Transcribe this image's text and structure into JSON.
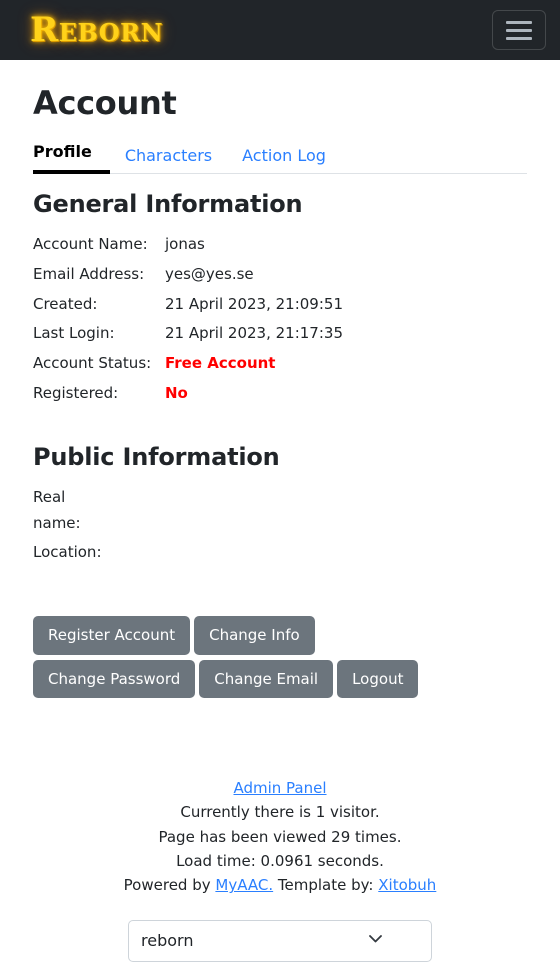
{
  "navbar": {
    "brand": "Reborn",
    "toggler_icon": "hamburger-menu-icon"
  },
  "page": {
    "title": "Account"
  },
  "tabs": [
    {
      "label": "Profile",
      "active": true
    },
    {
      "label": "Characters",
      "active": false
    },
    {
      "label": "Action Log",
      "active": false
    }
  ],
  "general_information": {
    "heading": "General Information",
    "rows": [
      {
        "label": "Account Name:",
        "value": "jonas",
        "status": false
      },
      {
        "label": "Email Address:",
        "value": "yes@yes.se",
        "status": false
      },
      {
        "label": "Created:",
        "value": "21 April 2023, 21:09:51",
        "status": false
      },
      {
        "label": "Last Login:",
        "value": "21 April 2023, 21:17:35",
        "status": false
      },
      {
        "label": "Account Status:",
        "value": "Free Account",
        "status": true
      },
      {
        "label": "Registered:",
        "value": "No",
        "status": true
      }
    ]
  },
  "public_information": {
    "heading": "Public Information",
    "rows": [
      {
        "label": "Real name:",
        "value": ""
      },
      {
        "label": "Location:",
        "value": ""
      }
    ]
  },
  "buttons": [
    {
      "label": "Register Account"
    },
    {
      "label": "Change Info"
    },
    {
      "label": "Change Password"
    },
    {
      "label": "Change Email"
    },
    {
      "label": "Logout"
    }
  ],
  "footer": {
    "admin_panel": "Admin Panel",
    "visitors": "Currently there is 1 visitor.",
    "views": "Page has been viewed 29 times.",
    "load_time": "Load time: 0.0961 seconds.",
    "powered_prefix": "Powered by ",
    "powered_link": "MyAAC.",
    "template_prefix": " Template by: ",
    "template_link": "Xitobuh"
  },
  "theme_select": {
    "value": "reborn",
    "options": [
      "reborn"
    ],
    "chevron_icon": "chevron-down-icon"
  },
  "colors": {
    "navbar_bg": "#212529",
    "brand": "#ffd21a",
    "link": "#2a7fff",
    "status_red": "#ff0000",
    "button_bg": "#6c757d"
  }
}
